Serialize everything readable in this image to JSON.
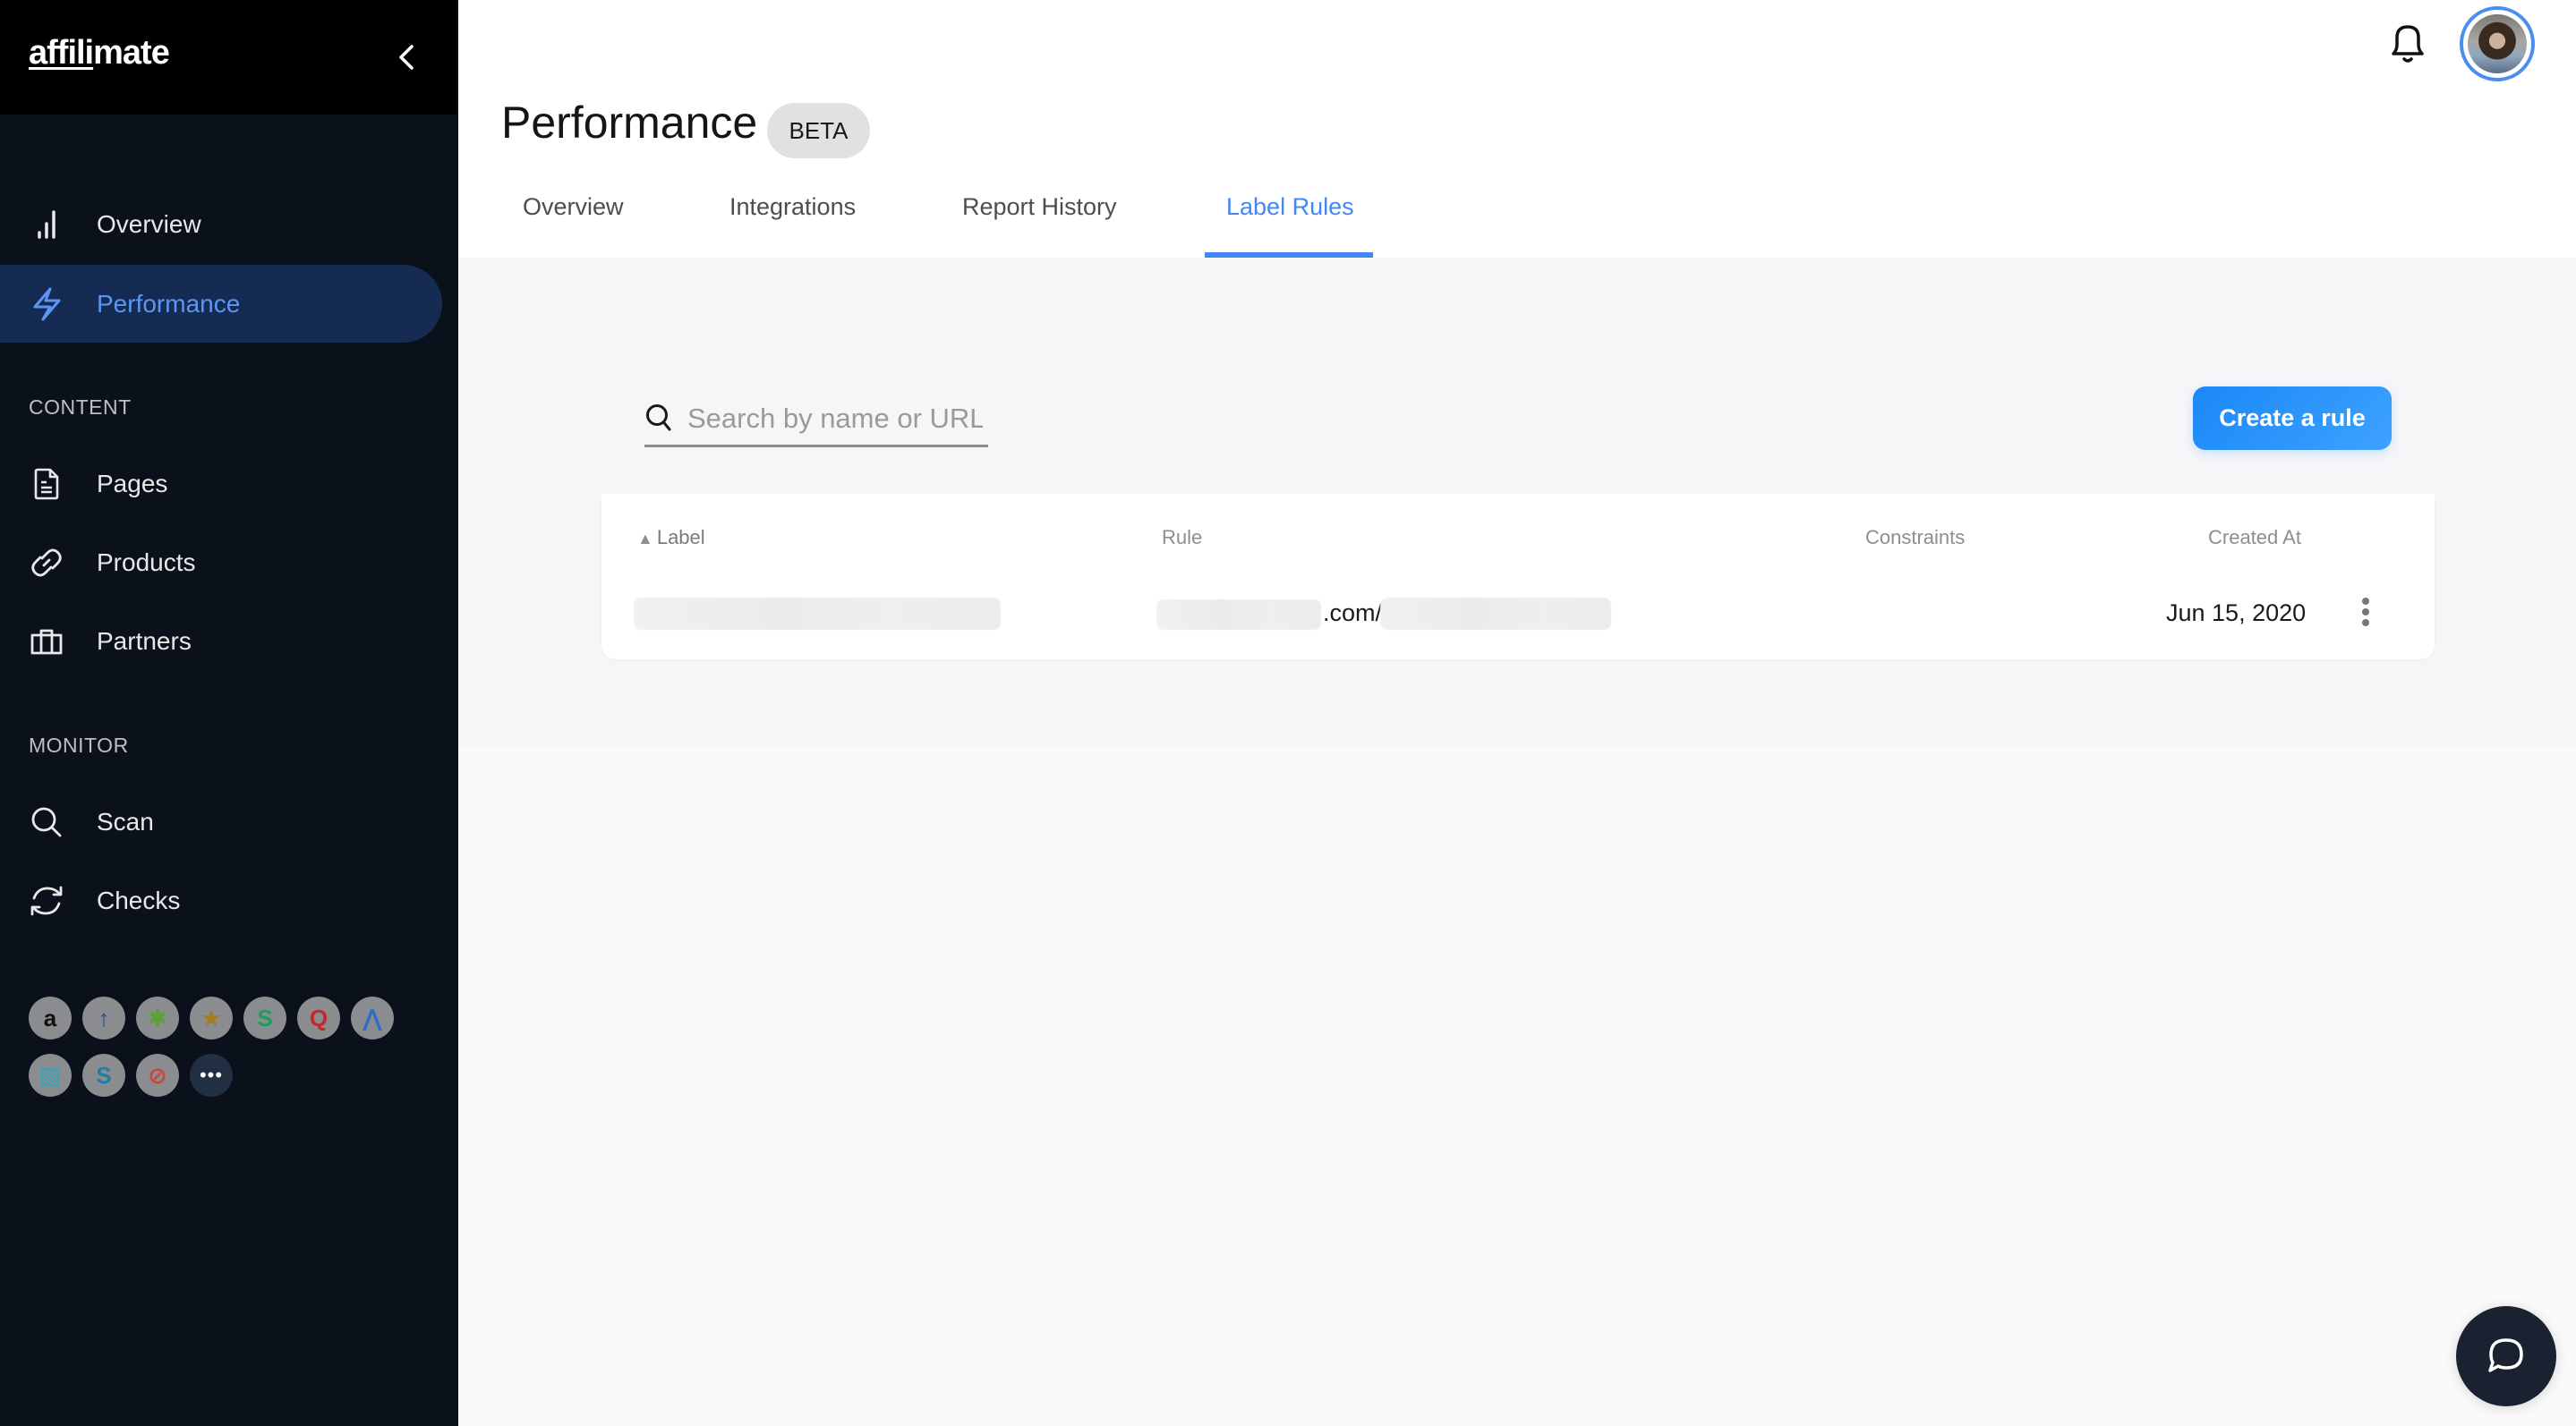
{
  "app": {
    "logo_underlined": "affili",
    "logo_rest": "mate"
  },
  "sidebar": {
    "collapse_label": "collapse sidebar",
    "items": [
      {
        "label": "Overview",
        "icon": "bar-chart-icon",
        "active": false
      },
      {
        "label": "Performance",
        "icon": "lightning-icon",
        "active": true
      }
    ],
    "sections": [
      {
        "title": "CONTENT",
        "items": [
          {
            "label": "Pages",
            "icon": "document-icon"
          },
          {
            "label": "Products",
            "icon": "link-icon"
          },
          {
            "label": "Partners",
            "icon": "briefcase-icon"
          }
        ]
      },
      {
        "title": "MONITOR",
        "items": [
          {
            "label": "Scan",
            "icon": "search-icon"
          },
          {
            "label": "Checks",
            "icon": "refresh-icon"
          }
        ]
      }
    ],
    "partners": [
      {
        "name": "amazon",
        "glyph": "a",
        "color": "#111111"
      },
      {
        "name": "partner-arrows",
        "glyph": "↑",
        "color": "#1e4f8f"
      },
      {
        "name": "partner-asterisk",
        "glyph": "✱",
        "color": "#5aa332"
      },
      {
        "name": "partner-star",
        "glyph": "★",
        "color": "#a37a1e"
      },
      {
        "name": "partner-s-green",
        "glyph": "S",
        "color": "#1a9e5a"
      },
      {
        "name": "partner-q-red",
        "glyph": "Q",
        "color": "#c0282d"
      },
      {
        "name": "partner-triangle",
        "glyph": "⋀",
        "color": "#2d6ec4"
      },
      {
        "name": "partner-stripes",
        "glyph": "▧",
        "color": "#2aa8c8"
      },
      {
        "name": "partner-s-teal",
        "glyph": "S",
        "color": "#1f7fa0"
      },
      {
        "name": "partner-link-red",
        "glyph": "⊘",
        "color": "#d0423a"
      }
    ],
    "more_label": "•••"
  },
  "header": {
    "title": "Performance",
    "badge": "BETA",
    "tabs": [
      {
        "label": "Overview",
        "active": false
      },
      {
        "label": "Integrations",
        "active": false
      },
      {
        "label": "Report History",
        "active": false
      },
      {
        "label": "Label Rules",
        "active": true
      }
    ],
    "notifications_label": "notifications",
    "avatar_label": "user avatar"
  },
  "label_rules": {
    "search": {
      "placeholder": "Search by name or URL",
      "value": ""
    },
    "create_button": "Create a rule",
    "table": {
      "columns": [
        {
          "label": "Label",
          "sorted": "asc"
        },
        {
          "label": "Rule"
        },
        {
          "label": "Constraints"
        },
        {
          "label": "Created At"
        }
      ],
      "rows": [
        {
          "label": "[redacted]",
          "rule_prefix": "[redacted]",
          "rule_middle": ".com/",
          "rule_suffix": "[redacted]",
          "constraints": "",
          "created_at": "Jun 15, 2020"
        }
      ]
    }
  },
  "colors": {
    "accent": "#4287f5",
    "sidebar_bg": "#0a111b",
    "sidebar_active_bg": "#162b52",
    "button_blue": "#1a88f7"
  }
}
